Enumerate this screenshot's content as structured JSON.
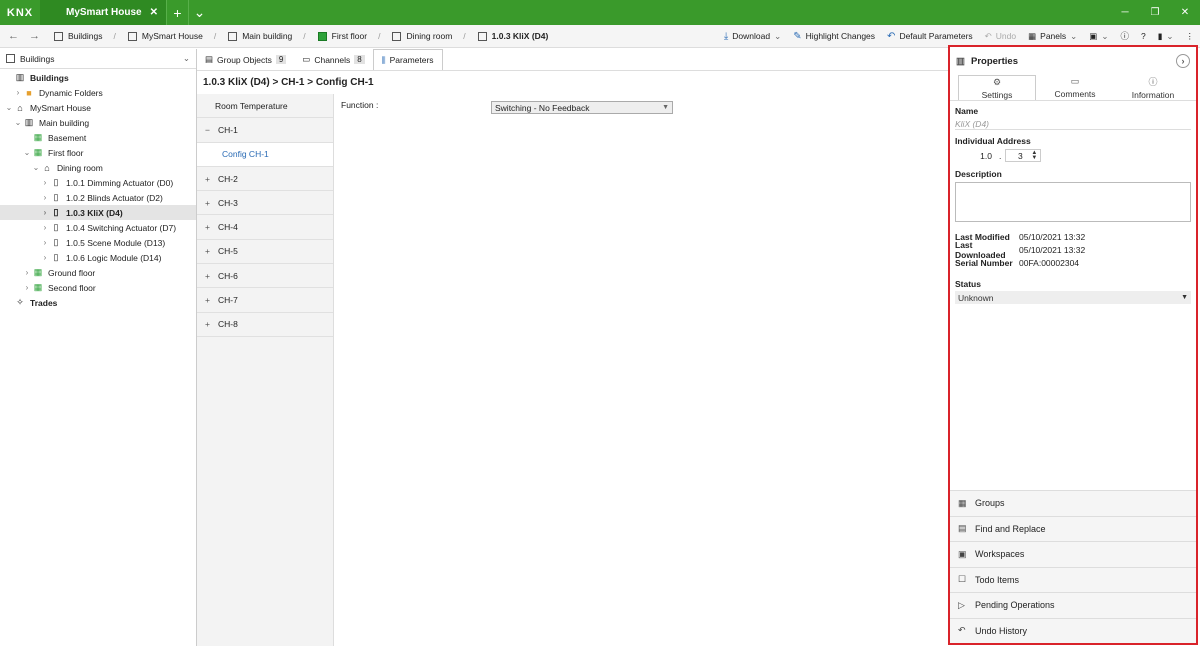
{
  "titlebar": {
    "logo": "KNX",
    "project_tab": "MySmart House",
    "close": "✕",
    "add": "+",
    "menu": "⌄",
    "minimize": "─",
    "restore": "❐",
    "window_close": "✕"
  },
  "navbar": {
    "back": "←",
    "forward": "→",
    "breadcrumbs": [
      "Buildings",
      "MySmart House",
      "Main building",
      "First floor",
      "Dining room",
      "1.0.3 KliX (D4)"
    ],
    "tools": {
      "download": "Download",
      "highlight": "Highlight Changes",
      "default_params": "Default Parameters",
      "undo": "Undo",
      "panels": "Panels"
    }
  },
  "left_panel": {
    "header": "Buildings",
    "tree": [
      {
        "label": "Buildings",
        "depth": 0,
        "icon": "building-icon",
        "twisty": "",
        "bold": true
      },
      {
        "label": "Dynamic Folders",
        "depth": 1,
        "icon": "folder-icon",
        "twisty": "›"
      },
      {
        "label": "MySmart House",
        "depth": 0,
        "icon": "house-icon",
        "twisty": "⌄"
      },
      {
        "label": "Main building",
        "depth": 1,
        "icon": "building-icon",
        "twisty": "⌄"
      },
      {
        "label": "Basement",
        "depth": 2,
        "icon": "floor-icon",
        "twisty": ""
      },
      {
        "label": "First floor",
        "depth": 2,
        "icon": "floor-icon",
        "twisty": "⌄"
      },
      {
        "label": "Dining room",
        "depth": 3,
        "icon": "room-icon",
        "twisty": "⌄"
      },
      {
        "label": "1.0.1 Dimming Actuator (D0)",
        "depth": 4,
        "icon": "device-icon",
        "twisty": "›"
      },
      {
        "label": "1.0.2 Blinds Actuator (D2)",
        "depth": 4,
        "icon": "device-icon",
        "twisty": "›"
      },
      {
        "label": "1.0.3 KliX (D4)",
        "depth": 4,
        "icon": "device-icon",
        "twisty": "›",
        "selected": true
      },
      {
        "label": "1.0.4 Switching Actuator (D7)",
        "depth": 4,
        "icon": "device-icon",
        "twisty": "›"
      },
      {
        "label": "1.0.5 Scene Module (D13)",
        "depth": 4,
        "icon": "device-icon",
        "twisty": "›"
      },
      {
        "label": "1.0.6 Logic Module (D14)",
        "depth": 4,
        "icon": "device-icon",
        "twisty": "›"
      },
      {
        "label": "Ground floor",
        "depth": 2,
        "icon": "floor-icon",
        "twisty": "›"
      },
      {
        "label": "Second floor",
        "depth": 2,
        "icon": "floor-icon",
        "twisty": "›"
      },
      {
        "label": "Trades",
        "depth": 0,
        "icon": "trades-icon",
        "twisty": "",
        "bold": true
      }
    ]
  },
  "mid_tabs": {
    "group_objects": "Group Objects",
    "group_objects_count": "9",
    "channels": "Channels",
    "channels_count": "8",
    "parameters": "Parameters"
  },
  "page_title": "1.0.3 KliX (D4) > CH-1 > Config CH-1",
  "channels": [
    {
      "label": "Room Temperature",
      "pm": ""
    },
    {
      "label": "CH-1",
      "pm": "−"
    },
    {
      "label": "Config CH-1",
      "pm": "",
      "sub": true
    },
    {
      "label": "CH-2",
      "pm": "+"
    },
    {
      "label": "CH-3",
      "pm": "+"
    },
    {
      "label": "CH-4",
      "pm": "+"
    },
    {
      "label": "CH-5",
      "pm": "+"
    },
    {
      "label": "CH-6",
      "pm": "+"
    },
    {
      "label": "CH-7",
      "pm": "+"
    },
    {
      "label": "CH-8",
      "pm": "+"
    }
  ],
  "params": {
    "function_label": "Function :",
    "function_value": "Switching - No Feedback"
  },
  "properties": {
    "title": "Properties",
    "tabs": [
      "Settings",
      "Comments",
      "Information"
    ],
    "name_label": "Name",
    "name_value": "KliX (D4)",
    "addr_label": "Individual Address",
    "addr_prefix": "1.0",
    "addr_sep": ".",
    "addr_value": "3",
    "desc_label": "Description",
    "last_modified_label": "Last Modified",
    "last_modified": "05/10/2021 13:32",
    "last_downloaded_label": "Last Downloaded",
    "last_downloaded": "05/10/2021 13:32",
    "serial_label": "Serial Number",
    "serial": "00FA:00002304",
    "status_label": "Status",
    "status_value": "Unknown",
    "bottom": [
      "Groups",
      "Find and Replace",
      "Workspaces",
      "Todo Items",
      "Pending Operations",
      "Undo History"
    ]
  },
  "colors": {
    "accent": "#3a9a2b",
    "highlight_border": "#d9232a",
    "link": "#2a6bb5"
  }
}
